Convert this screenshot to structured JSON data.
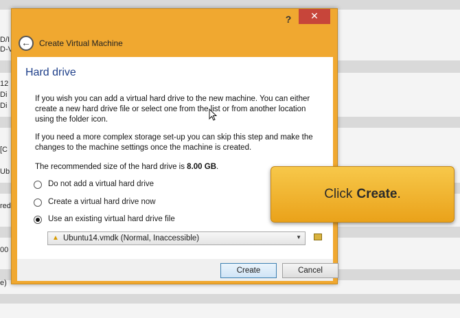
{
  "background": {
    "fragments": [
      "D/I",
      "D-V",
      "12",
      "Di",
      "Di",
      "[C",
      "Ub",
      "red",
      "00",
      "e)"
    ]
  },
  "dialog": {
    "help_label": "?",
    "close_label": "✕",
    "back_icon": "arrow-left-icon",
    "nav_title": "Create Virtual Machine",
    "page_title": "Hard drive",
    "para1": "If you wish you can add a virtual hard drive to the new machine. You can either create a new hard drive file or select one from the list or from another location using the folder icon.",
    "para2": "If you need a more complex storage set-up you can skip this step and make the changes to the machine settings once the machine is created.",
    "recommend_prefix": "The recommended size of the hard drive is ",
    "recommend_size": "8.00 GB",
    "recommend_suffix": ".",
    "options": [
      {
        "label": "Do not add a virtual hard drive",
        "checked": false
      },
      {
        "label": "Create a virtual hard drive now",
        "checked": false
      },
      {
        "label": "Use an existing virtual hard drive file",
        "checked": true
      }
    ],
    "combo_value": "Ubuntu14.vmdk (Normal, Inaccessible)",
    "create_label": "Create",
    "cancel_label": "Cancel"
  },
  "callout": {
    "prefix": "Click",
    "emphasis": "Create",
    "suffix": "."
  },
  "colors": {
    "dialog_frame": "#f0a830",
    "close_button": "#c7453a",
    "title_blue": "#1e3f8a",
    "callout": "#f2b52f"
  }
}
